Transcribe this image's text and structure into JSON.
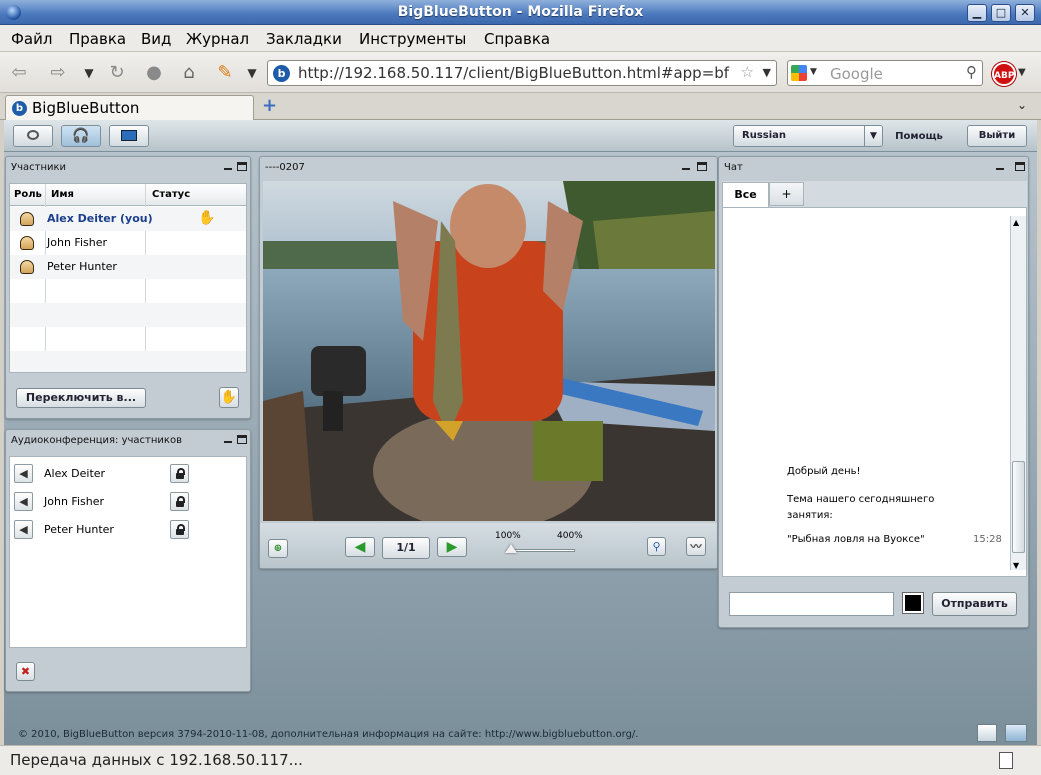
{
  "window": {
    "title": "BigBlueButton - Mozilla Firefox"
  },
  "menu": [
    "Файл",
    "Правка",
    "Вид",
    "Журнал",
    "Закладки",
    "Инструменты",
    "Справка"
  ],
  "nav": {
    "url": "http://192.168.50.117/client/BigBlueButton.html#app=bf",
    "search_placeholder": "Google",
    "abp": "ABP"
  },
  "tabs": [
    {
      "label": "BigBlueButton"
    }
  ],
  "app_toolbar": {
    "language": "Russian",
    "help": "Помощь",
    "logout": "Выйти"
  },
  "participants": {
    "title": "Участники",
    "columns": [
      "Роль",
      "Имя",
      "Статус"
    ],
    "rows": [
      {
        "name": "Alex Deiter (you)",
        "highlight": true
      },
      {
        "name": "John Fisher"
      },
      {
        "name": "Peter Hunter"
      }
    ],
    "switch_button": "Переключить в..."
  },
  "audio": {
    "title": "Аудиоконференция: участников",
    "rows": [
      {
        "name": "Alex Deiter"
      },
      {
        "name": "John Fisher"
      },
      {
        "name": "Peter Hunter"
      }
    ]
  },
  "presentation": {
    "title": "----0207",
    "page": "1/1",
    "zoom_min": "100%",
    "zoom_max": "400%",
    "zoom_level": 0.0
  },
  "chat": {
    "title": "Чат",
    "tabs": [
      "Все",
      "+"
    ],
    "messages": [
      {
        "text": "Добрый день!"
      },
      {
        "text": "Тема нашего сегодняшнего"
      },
      {
        "text": "занятия:"
      },
      {
        "text": "\"Рыбная ловля на Вуоксе\"",
        "time": "15:28"
      }
    ],
    "send": "Отправить"
  },
  "footer": "© 2010, BigBlueButton версия 3794-2010-11-08, дополнительная информация на сайте: http://www.bigbluebutton.org/.",
  "status": "Передача данных с 192.168.50.117..."
}
